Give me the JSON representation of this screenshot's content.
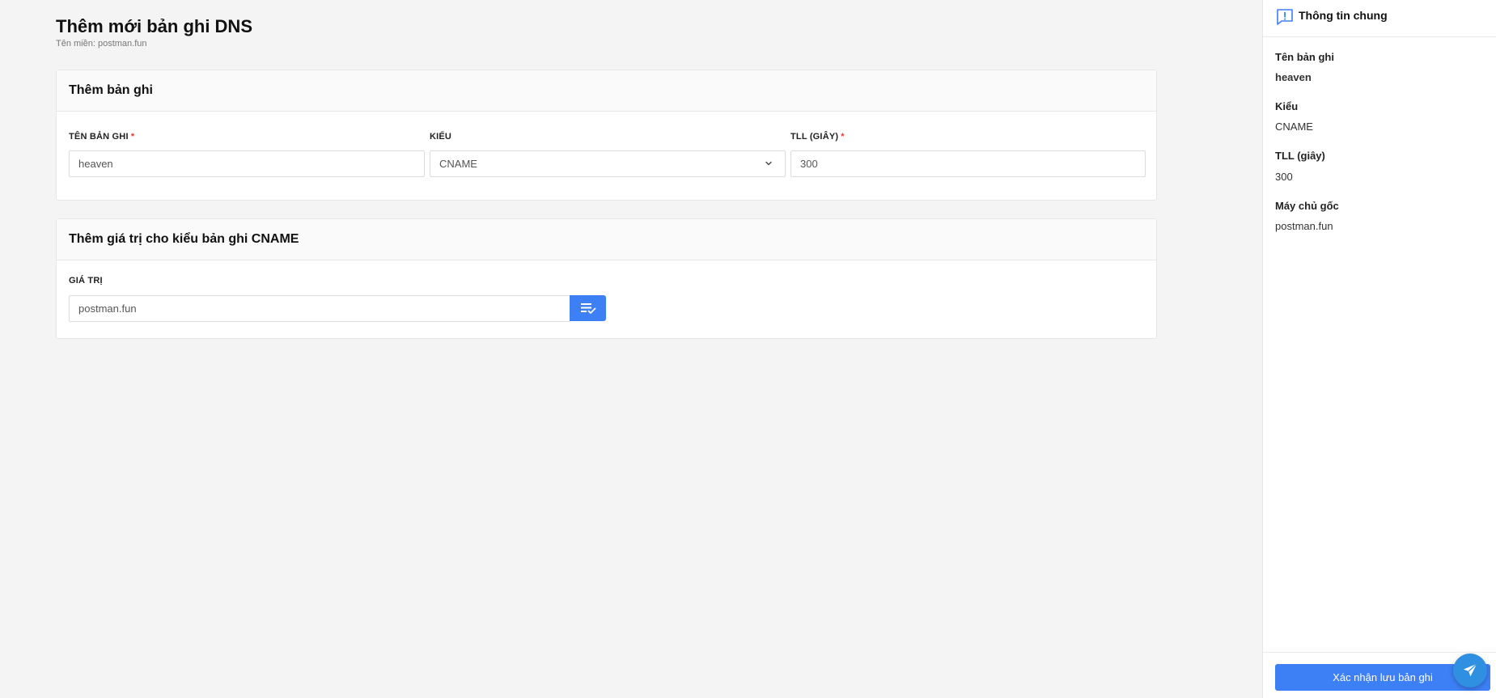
{
  "page": {
    "title": "Thêm mới bản ghi DNS",
    "subtitle": "Tên miền: postman.fun"
  },
  "record_card": {
    "title": "Thêm bản ghi",
    "name_label": "TÊN BẢN GHI",
    "name_value": "heaven",
    "type_label": "KIỂU",
    "type_value": "CNAME",
    "ttl_label": "TLL (GIÂY)",
    "ttl_value": "300",
    "required_mark": "*"
  },
  "value_card": {
    "title": "Thêm giá trị cho kiểu bản ghi CNAME",
    "value_label": "GIÁ TRỊ",
    "value_value": "postman.fun"
  },
  "sidebar": {
    "title": "Thông tin chung",
    "fields": [
      {
        "label": "Tên bản ghi",
        "value": "heaven"
      },
      {
        "label": "Kiểu",
        "value": "CNAME"
      },
      {
        "label": "TLL (giây)",
        "value": "300"
      },
      {
        "label": "Máy chủ gốc",
        "value": "postman.fun"
      }
    ],
    "save_label": "Xác nhận lưu bản ghi"
  },
  "icons": {
    "info": "info-bubble-icon",
    "select_arrow": "chevron-down-icon",
    "list": "list-check-icon",
    "send": "send-plane-icon"
  },
  "colors": {
    "accent": "#3d7ff5",
    "required": "#e53935",
    "background": "#f4f4f4"
  }
}
